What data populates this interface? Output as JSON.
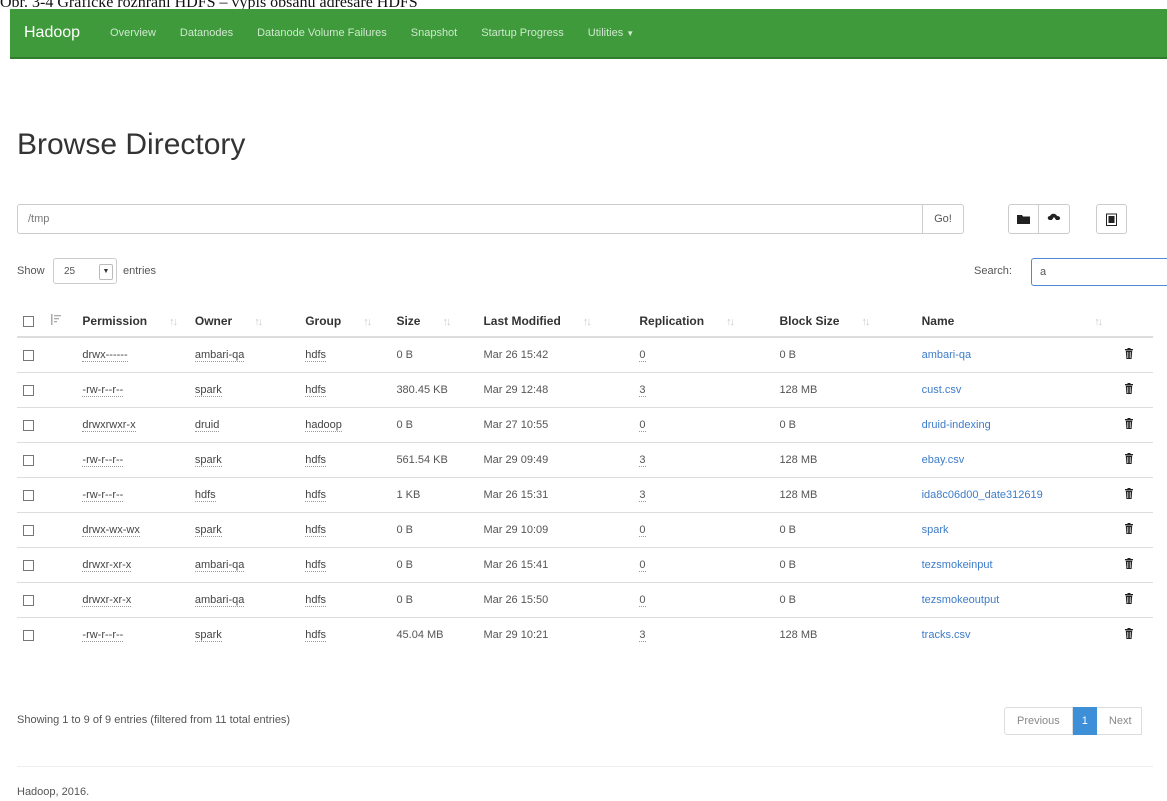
{
  "caption": "Obr. 3-4 Grafické rozhraní HDFS – výpis obsahu adresáře HDFS",
  "navbar": {
    "brand": "Hadoop",
    "items": [
      "Overview",
      "Datanodes",
      "Datanode Volume Failures",
      "Snapshot",
      "Startup Progress",
      "Utilities"
    ],
    "color": "#3e9a3b"
  },
  "page": {
    "title": "Browse Directory"
  },
  "path": {
    "value": "/tmp",
    "go_label": "Go!"
  },
  "toolbar": {
    "icons": [
      "folder-icon",
      "upload-icon",
      "clipboard-icon"
    ]
  },
  "controls": {
    "show_label": "Show",
    "entries_value": "25",
    "entries_label": "entries",
    "search_label": "Search:",
    "search_value": "a"
  },
  "table": {
    "headers": [
      "Permission",
      "Owner",
      "Group",
      "Size",
      "Last Modified",
      "Replication",
      "Block Size",
      "Name"
    ],
    "rows": [
      {
        "permission": "drwx------",
        "owner": "ambari-qa",
        "group": "hdfs",
        "size": "0 B",
        "modified": "Mar 26 15:42",
        "replication": "0",
        "block": "0 B",
        "name": "ambari-qa"
      },
      {
        "permission": "-rw-r--r--",
        "owner": "spark",
        "group": "hdfs",
        "size": "380.45 KB",
        "modified": "Mar 29 12:48",
        "replication": "3",
        "block": "128 MB",
        "name": "cust.csv"
      },
      {
        "permission": "drwxrwxr-x",
        "owner": "druid",
        "group": "hadoop",
        "size": "0 B",
        "modified": "Mar 27 10:55",
        "replication": "0",
        "block": "0 B",
        "name": "druid-indexing"
      },
      {
        "permission": "-rw-r--r--",
        "owner": "spark",
        "group": "hdfs",
        "size": "561.54 KB",
        "modified": "Mar 29 09:49",
        "replication": "3",
        "block": "128 MB",
        "name": "ebay.csv"
      },
      {
        "permission": "-rw-r--r--",
        "owner": "hdfs",
        "group": "hdfs",
        "size": "1 KB",
        "modified": "Mar 26 15:31",
        "replication": "3",
        "block": "128 MB",
        "name": "ida8c06d00_date312619"
      },
      {
        "permission": "drwx-wx-wx",
        "owner": "spark",
        "group": "hdfs",
        "size": "0 B",
        "modified": "Mar 29 10:09",
        "replication": "0",
        "block": "0 B",
        "name": "spark"
      },
      {
        "permission": "drwxr-xr-x",
        "owner": "ambari-qa",
        "group": "hdfs",
        "size": "0 B",
        "modified": "Mar 26 15:41",
        "replication": "0",
        "block": "0 B",
        "name": "tezsmokeinput"
      },
      {
        "permission": "drwxr-xr-x",
        "owner": "ambari-qa",
        "group": "hdfs",
        "size": "0 B",
        "modified": "Mar 26 15:50",
        "replication": "0",
        "block": "0 B",
        "name": "tezsmokeoutput"
      },
      {
        "permission": "-rw-r--r--",
        "owner": "spark",
        "group": "hdfs",
        "size": "45.04 MB",
        "modified": "Mar 29 10:21",
        "replication": "3",
        "block": "128 MB",
        "name": "tracks.csv"
      }
    ]
  },
  "footer": {
    "info": "Showing 1 to 9 of 9 entries (filtered from 11 total entries)",
    "prev_label": "Previous",
    "page_label": "1",
    "next_label": "Next",
    "copyright": "Hadoop, 2016."
  }
}
